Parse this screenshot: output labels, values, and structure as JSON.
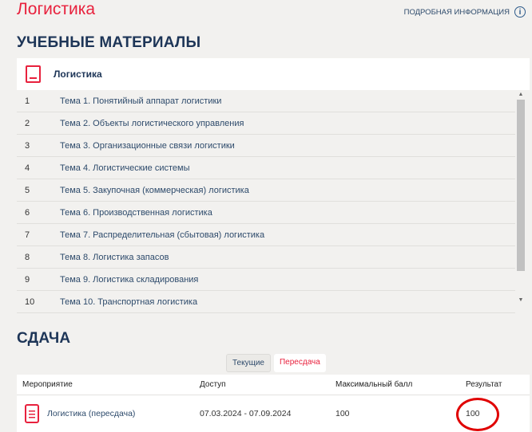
{
  "page_title": "Логистика",
  "info_link": "ПОДРОБНАЯ ИНФОРМАЦИЯ",
  "materials": {
    "heading": "УЧЕБНЫЕ МАТЕРИАЛЫ",
    "course": "Логистика",
    "items": [
      {
        "n": "1",
        "label": "Тема 1. Понятийный аппарат логистики"
      },
      {
        "n": "2",
        "label": "Тема 2. Объекты логистического управления"
      },
      {
        "n": "3",
        "label": "Тема 3. Организационные связи логистики"
      },
      {
        "n": "4",
        "label": "Тема 4. Логистические системы"
      },
      {
        "n": "5",
        "label": "Тема 5. Закупочная (коммерческая) логистика"
      },
      {
        "n": "6",
        "label": "Тема 6. Производственная логистика"
      },
      {
        "n": "7",
        "label": "Тема 7. Распределительная (сбытовая) логистика"
      },
      {
        "n": "8",
        "label": "Тема 8. Логистика запасов"
      },
      {
        "n": "9",
        "label": "Тема 9. Логистика складирования"
      },
      {
        "n": "10",
        "label": "Тема 10. Транспортная логистика"
      }
    ]
  },
  "submission": {
    "heading": "СДАЧА",
    "tabs": [
      "Текущие",
      "Пересдача"
    ],
    "columns": [
      "Мероприятие",
      "Доступ",
      "Максимальный балл",
      "Результат"
    ],
    "rows": [
      {
        "event": "Логистика (пересдача)",
        "access": "07.03.2024 - 07.09.2024",
        "max": "100",
        "result": "100"
      }
    ]
  }
}
